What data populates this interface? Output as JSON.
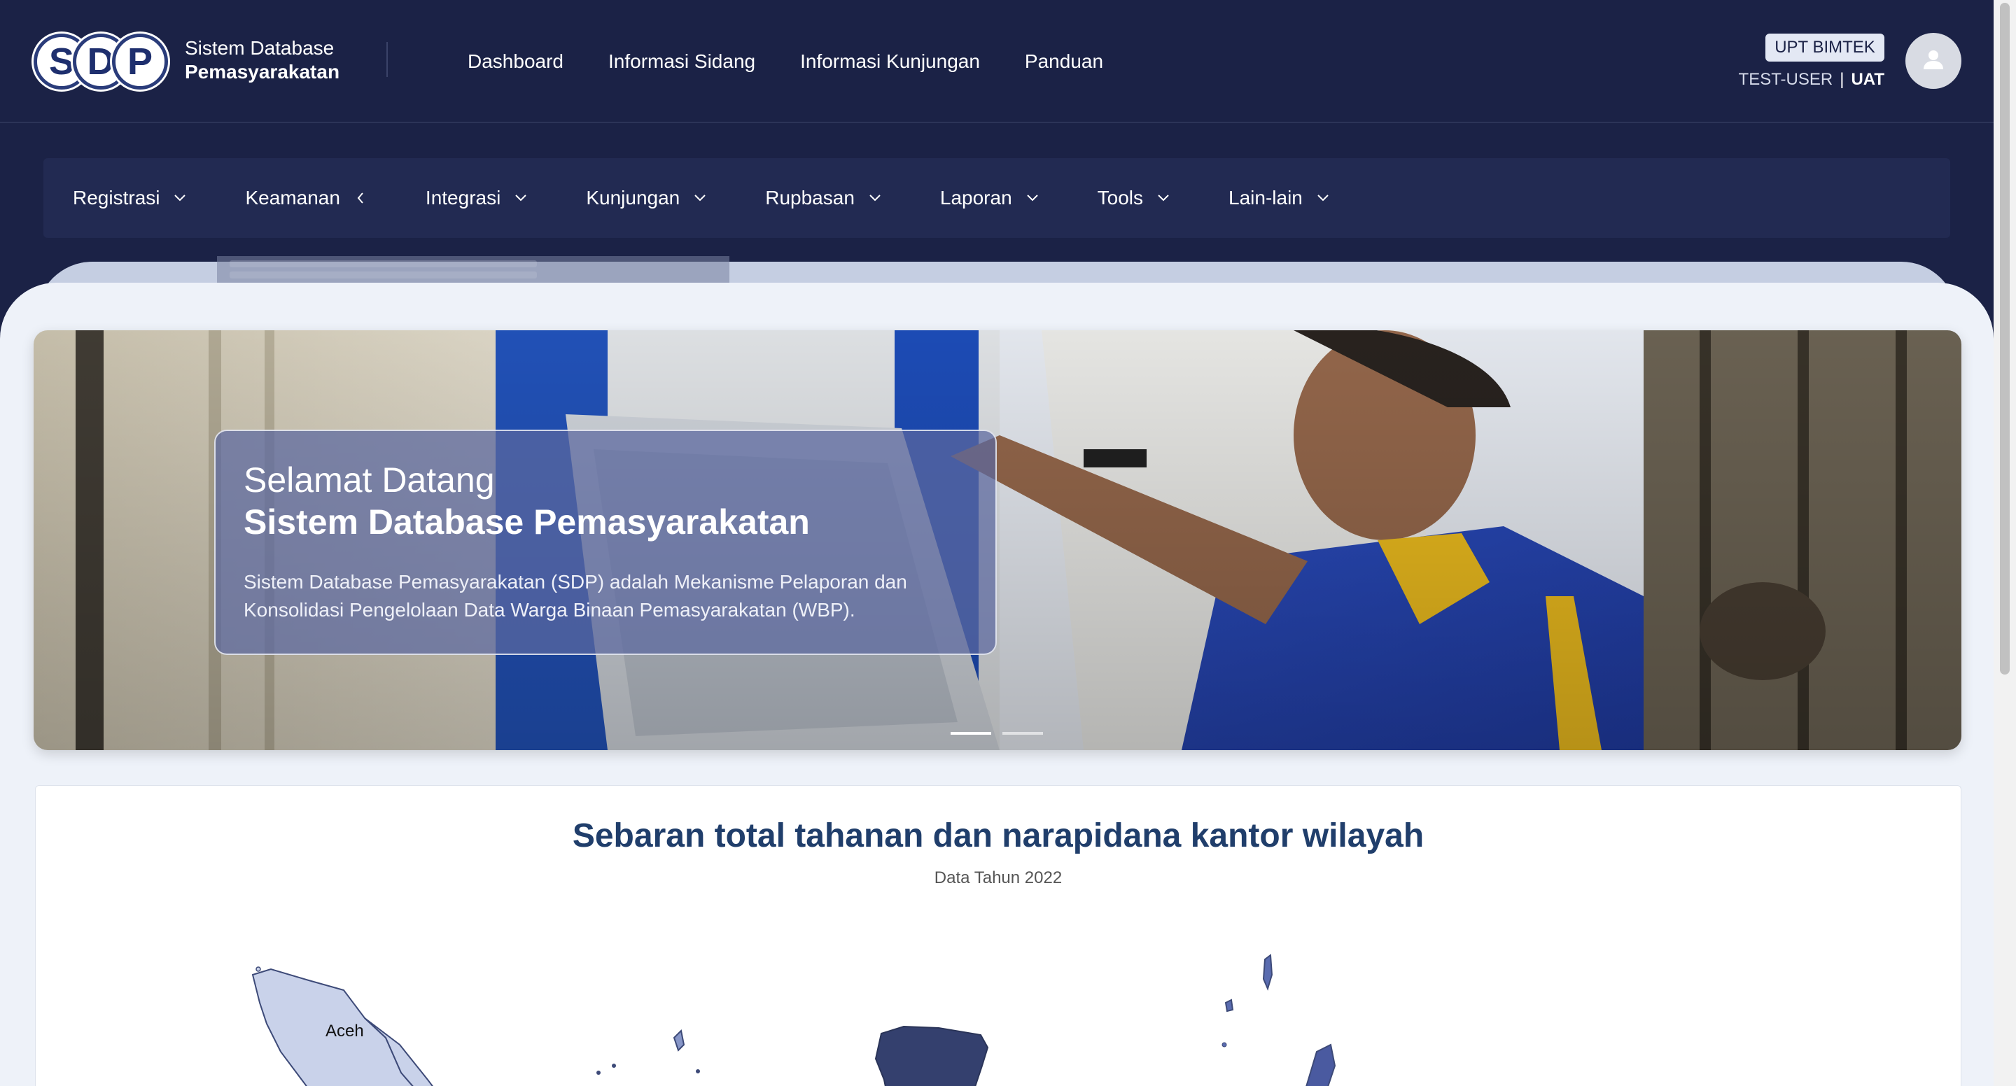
{
  "header": {
    "logo_letters": [
      "S",
      "D",
      "P"
    ],
    "brand_line1": "Sistem Database",
    "brand_line2": "Pemasyarakatan",
    "nav": [
      "Dashboard",
      "Informasi Sidang",
      "Informasi Kunjungan",
      "Panduan"
    ],
    "unit_badge": "UPT BIMTEK",
    "user": "TEST-USER",
    "separator": "|",
    "env": "UAT"
  },
  "menu": [
    {
      "label": "Registrasi",
      "chevron": "down"
    },
    {
      "label": "Keamanan",
      "chevron": "left"
    },
    {
      "label": "Integrasi",
      "chevron": "down"
    },
    {
      "label": "Kunjungan",
      "chevron": "down"
    },
    {
      "label": "Rupbasan",
      "chevron": "down"
    },
    {
      "label": "Laporan",
      "chevron": "down"
    },
    {
      "label": "Tools",
      "chevron": "down"
    },
    {
      "label": "Lain-lain",
      "chevron": "down"
    }
  ],
  "hero": {
    "title_line1": "Selamat Datang",
    "title_line2": "Sistem Database Pemasyarakatan",
    "description": "Sistem Database Pemasyarakatan (SDP) adalah Mekanisme Pelaporan dan Konsolidasi Pengelolaan Data Warga Binaan Pemasyarakatan (WBP).",
    "slides": 2,
    "active_slide": 1
  },
  "map": {
    "title": "Sebaran total tahanan dan narapidana kantor wilayah",
    "subtitle": "Data Tahun 2022",
    "region_label": "Aceh"
  },
  "colors": {
    "header_bg": "#1b2246",
    "menubar_bg": "#222a52",
    "content_bg": "#eef2f9",
    "title_blue": "#203e6b",
    "map_dark": "#34406e",
    "map_mid": "#5a6cb0",
    "map_light": "#c9d2ea"
  },
  "icons": {
    "avatar": "user-icon",
    "chevron_down": "chevron-down-icon",
    "chevron_left": "chevron-left-icon"
  }
}
